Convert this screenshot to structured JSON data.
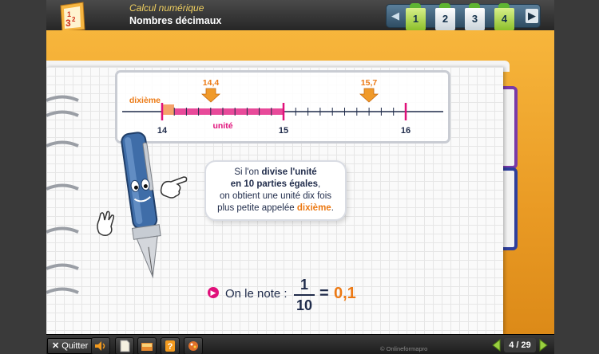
{
  "header": {
    "subtitle_italic": "Calcul numérique",
    "title": "Nombres décimaux",
    "chapters": [
      {
        "label": "1",
        "active": true
      },
      {
        "label": "2",
        "active": false
      },
      {
        "label": "3",
        "active": false
      },
      {
        "label": "4",
        "active": true
      }
    ]
  },
  "number_line": {
    "label_dixieme": "dixième",
    "label_unite": "unité",
    "tick_labels": [
      "14",
      "15",
      "16"
    ],
    "markers": [
      "14,4",
      "15,7"
    ]
  },
  "bubble": {
    "line1_pre": "Si l'on ",
    "line1_bold": "divise l'unité",
    "line2_bold": "en 10 parties égales",
    "line2_post": ",",
    "line3": "on obtient une unité dix fois",
    "line4_pre": "plus petite appelée ",
    "line4_hl": "dixième",
    "line4_post": "."
  },
  "notation": {
    "label": "On le note :",
    "numerator": "1",
    "denominator": "10",
    "equals": "=",
    "result": "0,1"
  },
  "toolbar": {
    "quit_label": "Quitter",
    "copyright": "© Onlineformapro",
    "page_indicator": "4 / 29"
  },
  "colors": {
    "accent_orange": "#ec7a15",
    "accent_magenta": "#e0107a",
    "binder": "#f0a830"
  }
}
